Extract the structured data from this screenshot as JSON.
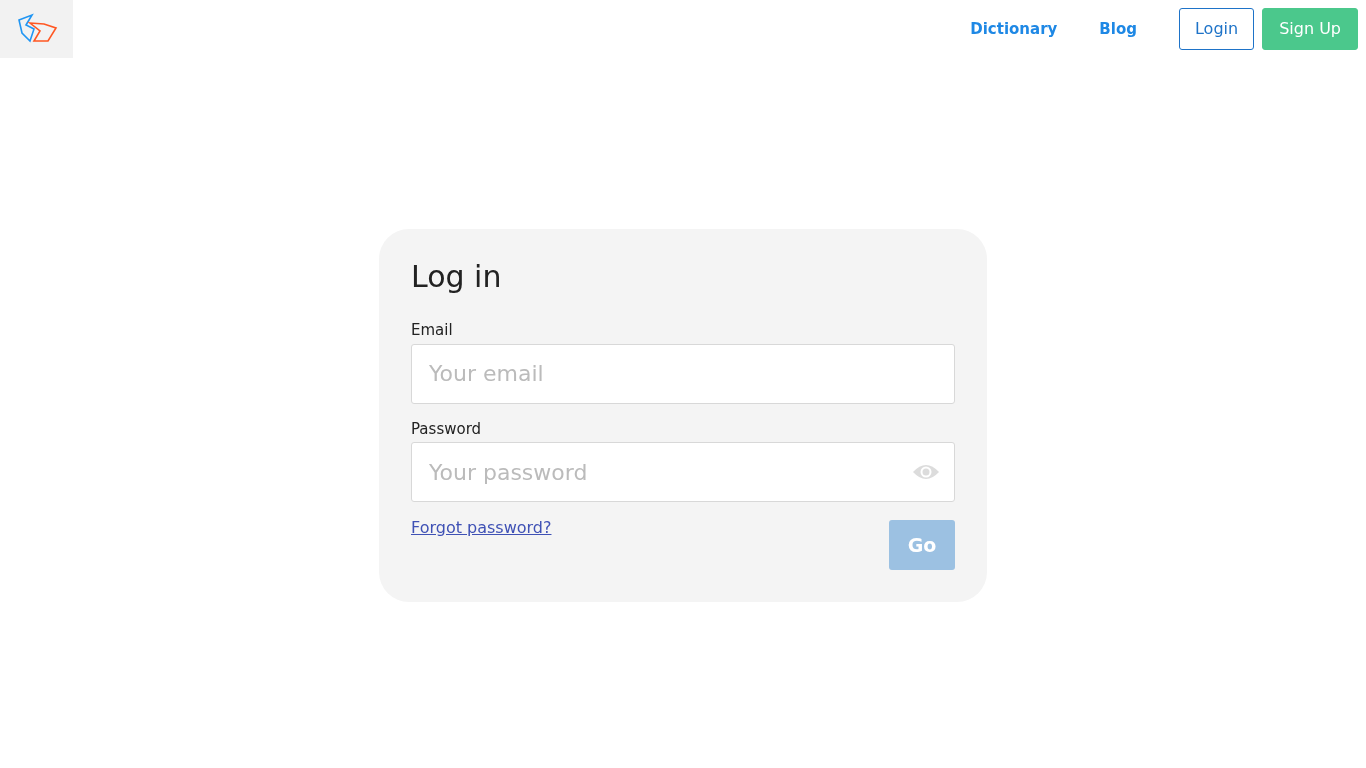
{
  "navbar": {
    "links": [
      {
        "label": "Dictionary"
      },
      {
        "label": "Blog"
      }
    ],
    "buttons": [
      {
        "label": "Login",
        "kind": "outline"
      },
      {
        "label": "Sign Up",
        "kind": "filled"
      }
    ]
  },
  "form": {
    "title": "Log in",
    "fields": [
      {
        "label": "Email",
        "placeholder": "Your email",
        "kind": "email"
      },
      {
        "label": "Password",
        "placeholder": "Your password",
        "kind": "password"
      }
    ],
    "forgot_link": "Forgot password?",
    "submit": {
      "label": "Go",
      "disabled": true
    }
  }
}
